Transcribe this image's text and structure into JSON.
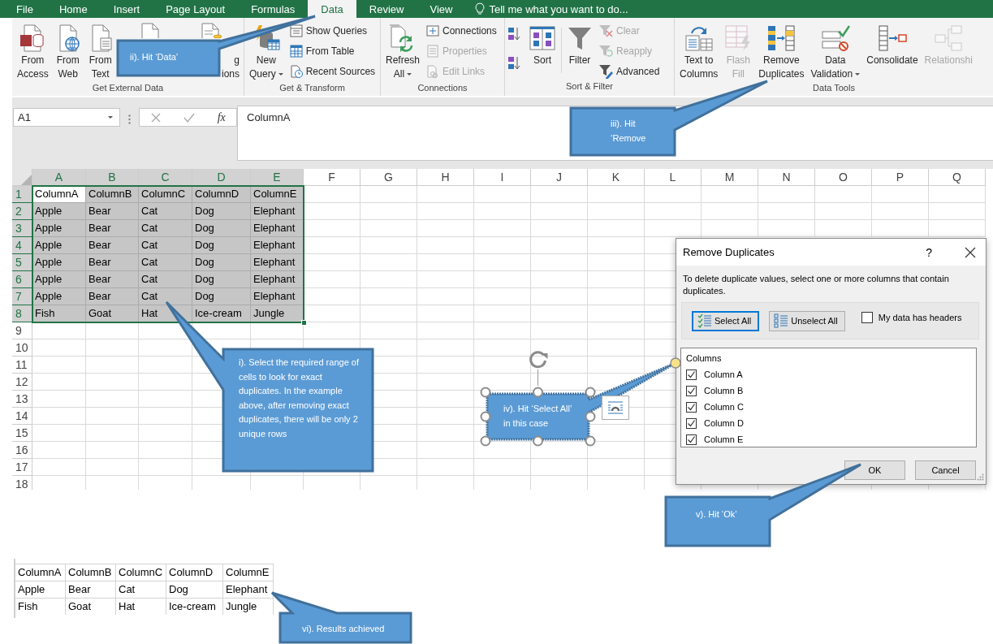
{
  "tabs": [
    {
      "label": "File",
      "selected": false
    },
    {
      "label": "Home",
      "selected": false
    },
    {
      "label": "Insert",
      "selected": false
    },
    {
      "label": "Page Layout",
      "selected": false
    },
    {
      "label": "Formulas",
      "selected": false
    },
    {
      "label": "Data",
      "selected": true
    },
    {
      "label": "Review",
      "selected": false
    },
    {
      "label": "View",
      "selected": false
    }
  ],
  "tell_me": "Tell me what you want to do...",
  "ribbon": {
    "groups": [
      {
        "label": "Get External Data",
        "items": [
          {
            "kind": "large",
            "lines": [
              "From",
              "Access"
            ],
            "disabled": false,
            "dropdown": false
          },
          {
            "kind": "large",
            "lines": [
              "From",
              "Web"
            ],
            "disabled": false,
            "dropdown": false
          },
          {
            "kind": "large",
            "lines": [
              "From",
              "Text"
            ],
            "disabled": false,
            "dropdown": false
          },
          {
            "kind": "covered"
          },
          {
            "kind": "partial",
            "lines": [
              "g",
              "ions"
            ],
            "disabled": false
          }
        ]
      },
      {
        "label": "Get & Transform",
        "items": [
          {
            "kind": "large",
            "lines": [
              "New",
              "Query"
            ],
            "disabled": false,
            "dropdown": true
          },
          {
            "kind": "stack",
            "items": [
              {
                "label": "Show Queries",
                "disabled": false
              },
              {
                "label": "From Table",
                "disabled": false
              },
              {
                "label": "Recent Sources",
                "disabled": false
              }
            ]
          }
        ]
      },
      {
        "label": "Connections",
        "items": [
          {
            "kind": "large",
            "lines": [
              "Refresh",
              "All"
            ],
            "disabled": false,
            "dropdown": true
          },
          {
            "kind": "stack",
            "items": [
              {
                "label": "Connections",
                "disabled": false
              },
              {
                "label": "Properties",
                "disabled": true
              },
              {
                "label": "Edit Links",
                "disabled": true
              }
            ]
          }
        ]
      },
      {
        "label": "Sort & Filter",
        "items": [
          {
            "kind": "sort_pair"
          },
          {
            "kind": "large",
            "lines": [
              "Sort"
            ],
            "disabled": false,
            "dropdown": false
          },
          {
            "kind": "large",
            "lines": [
              "Filter"
            ],
            "disabled": false,
            "dropdown": false
          },
          {
            "kind": "stack",
            "items": [
              {
                "label": "Clear",
                "disabled": true
              },
              {
                "label": "Reapply",
                "disabled": true
              },
              {
                "label": "Advanced",
                "disabled": false
              }
            ]
          }
        ]
      },
      {
        "label": "Data Tools",
        "items": [
          {
            "kind": "large",
            "lines": [
              "Text to",
              "Columns"
            ],
            "disabled": false,
            "dropdown": false
          },
          {
            "kind": "large",
            "lines": [
              "Flash",
              "Fill"
            ],
            "disabled": true,
            "dropdown": false
          },
          {
            "kind": "large",
            "lines": [
              "Remove",
              "Duplicates"
            ],
            "disabled": false,
            "dropdown": false
          },
          {
            "kind": "large",
            "lines": [
              "Data",
              "Validation"
            ],
            "disabled": false,
            "dropdown": true
          },
          {
            "kind": "large",
            "lines": [
              "Consolidate"
            ],
            "disabled": false,
            "dropdown": false
          },
          {
            "kind": "large",
            "lines": [
              "Relationshi"
            ],
            "disabled": true,
            "dropdown": false
          }
        ]
      }
    ]
  },
  "formula_bar": {
    "name_box": "A1",
    "function_button": "fx",
    "value": "ColumnA"
  },
  "sheet": {
    "columns": [
      {
        "label": "A",
        "selected": true
      },
      {
        "label": "B",
        "selected": true
      },
      {
        "label": "C",
        "selected": true
      },
      {
        "label": "D",
        "selected": true
      },
      {
        "label": "E",
        "selected": true
      },
      {
        "label": "F",
        "selected": false
      },
      {
        "label": "G",
        "selected": false
      },
      {
        "label": "H",
        "selected": false
      },
      {
        "label": "I",
        "selected": false
      },
      {
        "label": "J",
        "selected": false
      },
      {
        "label": "K",
        "selected": false
      },
      {
        "label": "L",
        "selected": false
      },
      {
        "label": "M",
        "selected": false
      },
      {
        "label": "N",
        "selected": false
      },
      {
        "label": "O",
        "selected": false
      },
      {
        "label": "P",
        "selected": false
      },
      {
        "label": "Q",
        "selected": false
      }
    ],
    "rows": [
      {
        "label": "1",
        "selected": true,
        "cells": [
          {
            "text": "ColumnA",
            "active": true
          },
          {
            "text": "ColumnB",
            "active": false
          },
          {
            "text": "ColumnC",
            "active": false
          },
          {
            "text": "ColumnD",
            "active": false
          },
          {
            "text": "ColumnE",
            "active": false
          }
        ]
      },
      {
        "label": "2",
        "selected": true,
        "cells": [
          {
            "text": "Apple",
            "active": false
          },
          {
            "text": "Bear",
            "active": false
          },
          {
            "text": "Cat",
            "active": false
          },
          {
            "text": "Dog",
            "active": false
          },
          {
            "text": "Elephant",
            "active": false
          }
        ]
      },
      {
        "label": "3",
        "selected": true,
        "cells": [
          {
            "text": "Apple",
            "active": false
          },
          {
            "text": "Bear",
            "active": false
          },
          {
            "text": "Cat",
            "active": false
          },
          {
            "text": "Dog",
            "active": false
          },
          {
            "text": "Elephant",
            "active": false
          }
        ]
      },
      {
        "label": "4",
        "selected": true,
        "cells": [
          {
            "text": "Apple",
            "active": false
          },
          {
            "text": "Bear",
            "active": false
          },
          {
            "text": "Cat",
            "active": false
          },
          {
            "text": "Dog",
            "active": false
          },
          {
            "text": "Elephant",
            "active": false
          }
        ]
      },
      {
        "label": "5",
        "selected": true,
        "cells": [
          {
            "text": "Apple",
            "active": false
          },
          {
            "text": "Bear",
            "active": false
          },
          {
            "text": "Cat",
            "active": false
          },
          {
            "text": "Dog",
            "active": false
          },
          {
            "text": "Elephant",
            "active": false
          }
        ]
      },
      {
        "label": "6",
        "selected": true,
        "cells": [
          {
            "text": "Apple",
            "active": false
          },
          {
            "text": "Bear",
            "active": false
          },
          {
            "text": "Cat",
            "active": false
          },
          {
            "text": "Dog",
            "active": false
          },
          {
            "text": "Elephant",
            "active": false
          }
        ]
      },
      {
        "label": "7",
        "selected": true,
        "cells": [
          {
            "text": "Apple",
            "active": false
          },
          {
            "text": "Bear",
            "active": false
          },
          {
            "text": "Cat",
            "active": false
          },
          {
            "text": "Dog",
            "active": false
          },
          {
            "text": "Elephant",
            "active": false
          }
        ]
      },
      {
        "label": "8",
        "selected": true,
        "cells": [
          {
            "text": "Fish",
            "active": false
          },
          {
            "text": "Goat",
            "active": false
          },
          {
            "text": "Hat",
            "active": false
          },
          {
            "text": "Ice-cream",
            "active": false
          },
          {
            "text": "Jungle",
            "active": false
          }
        ]
      },
      {
        "label": "9",
        "selected": false,
        "cells": []
      },
      {
        "label": "10",
        "selected": false,
        "cells": []
      },
      {
        "label": "11",
        "selected": false,
        "cells": []
      },
      {
        "label": "12",
        "selected": false,
        "cells": []
      },
      {
        "label": "13",
        "selected": false,
        "cells": []
      },
      {
        "label": "14",
        "selected": false,
        "cells": []
      },
      {
        "label": "15",
        "selected": false,
        "cells": []
      },
      {
        "label": "16",
        "selected": false,
        "cells": []
      },
      {
        "label": "17",
        "selected": false,
        "cells": []
      },
      {
        "label": "18",
        "selected": false,
        "cells": []
      }
    ]
  },
  "result_table": {
    "rows": [
      [
        "ColumnA",
        "ColumnB",
        "ColumnC",
        "ColumnD",
        "ColumnE"
      ],
      [
        "Apple",
        "Bear",
        "Cat",
        "Dog",
        "Elephant"
      ],
      [
        "Fish",
        "Goat",
        "Hat",
        "Ice-cream",
        "Jungle"
      ]
    ]
  },
  "dialog": {
    "title": "Remove Duplicates",
    "help": "?",
    "description": "To delete duplicate values, select one or more columns that contain duplicates.",
    "top_buttons": [
      {
        "label": "Select All",
        "focused": true
      },
      {
        "label": "Unselect All",
        "focused": false
      }
    ],
    "headers_checkbox": {
      "label": "My data has headers",
      "checked": false
    },
    "list_header": "Columns",
    "columns": [
      {
        "label": "Column A",
        "checked": true
      },
      {
        "label": "Column B",
        "checked": true
      },
      {
        "label": "Column C",
        "checked": true
      },
      {
        "label": "Column D",
        "checked": true
      },
      {
        "label": "Column E",
        "checked": true
      }
    ],
    "buttons": [
      {
        "label": "OK"
      },
      {
        "label": "Cancel"
      }
    ]
  },
  "callouts": [
    {
      "text": "i). Select the required range of cells to look for exact duplicates. In the example above, after removing exact duplicates, there will be only 2 unique rows",
      "selected": false
    },
    {
      "text": "ii). Hit ‘Data’",
      "selected": false
    },
    {
      "text": "iii). Hit ‘Remove",
      "selected": false
    },
    {
      "text": "iv). Hit ‘Select All’ in this case",
      "selected": true
    },
    {
      "text": "v). Hit ‘Ok’",
      "selected": false
    },
    {
      "text": "vi). Results achieved",
      "selected": false
    }
  ]
}
